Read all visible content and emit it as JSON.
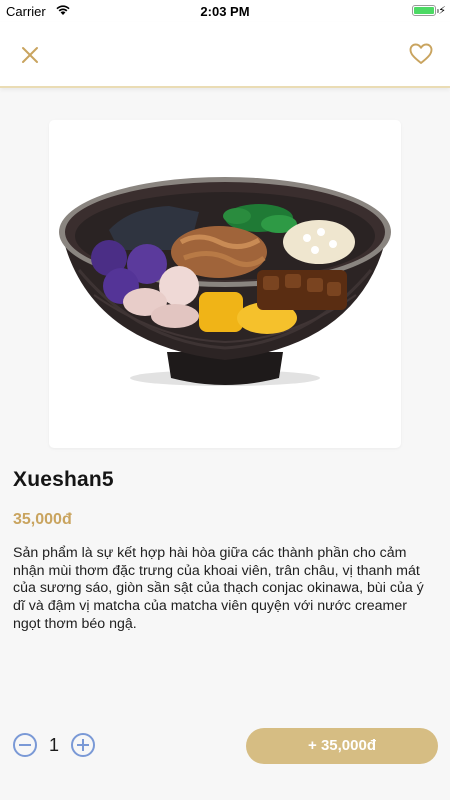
{
  "status_bar": {
    "carrier": "Carrier",
    "time": "2:03 PM",
    "battery_level_percent": 100,
    "battery_color": "#4cd964",
    "charging": true
  },
  "nav": {
    "close_icon": "close-icon",
    "favorite_icon": "heart-icon",
    "accent_color": "#c9a45f"
  },
  "product": {
    "image": "bowl-dessert-image",
    "name": "Xueshan5",
    "price": "35,000đ",
    "description": "Sản phẩm là sự kết hợp hài hòa giữa các thành phần cho cảm nhận mùi thơm đặc trưng của khoai viên, trân châu, vị thanh mát của sương sáo, giòn sần sật của thạch conjac okinawa, bùi của ý dĩ và đậm vị matcha của matcha viên quyện với nước creamer ngọt thơm béo ngậ."
  },
  "cart": {
    "quantity": "1",
    "minus_icon": "minus-circle-icon",
    "plus_icon": "plus-circle-icon",
    "add_button_label": "+ 35,000đ",
    "button_color": "#d6bd83"
  }
}
